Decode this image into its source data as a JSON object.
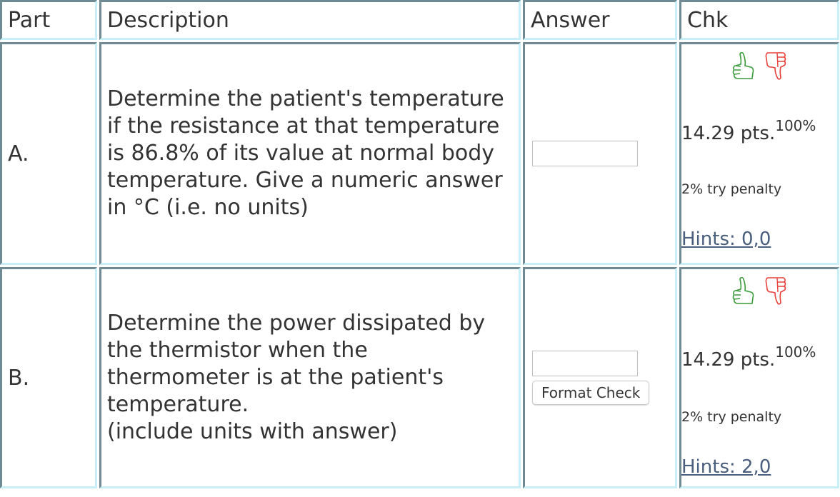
{
  "table": {
    "headers": {
      "part": "Part",
      "description": "Description",
      "answer": "Answer",
      "chk": "Chk"
    },
    "rows": [
      {
        "part": "A.",
        "description": "Determine the patient's temperature if the resistance at that temperature is 86.8% of its value at normal body temperature. Give a numeric answer in °C (i.e. no units)",
        "answer_value": "",
        "points": "14.29 pts.",
        "percent": "100%",
        "penalty": "2% try penalty",
        "hints": "Hints: 0,0",
        "has_format_check": false
      },
      {
        "part": "B.",
        "description_lines": [
          "Determine the power dissipated by the thermistor when the thermometer is at the patient's temperature.",
          "(include units with answer)"
        ],
        "answer_value": "",
        "format_check_label": "Format Check",
        "points": "14.29 pts.",
        "percent": "100%",
        "penalty": "2% try penalty",
        "hints": "Hints: 2,0",
        "has_format_check": true
      }
    ]
  },
  "icons": {
    "thumbs_up": "thumbs-up-icon",
    "thumbs_down": "thumbs-down-icon"
  },
  "colors": {
    "thumbs_up": "#3a9a3a",
    "thumbs_down": "#e8403a",
    "link": "#4a5e7e",
    "border_dark": "#708a94",
    "border_light": "#c8eef8"
  }
}
